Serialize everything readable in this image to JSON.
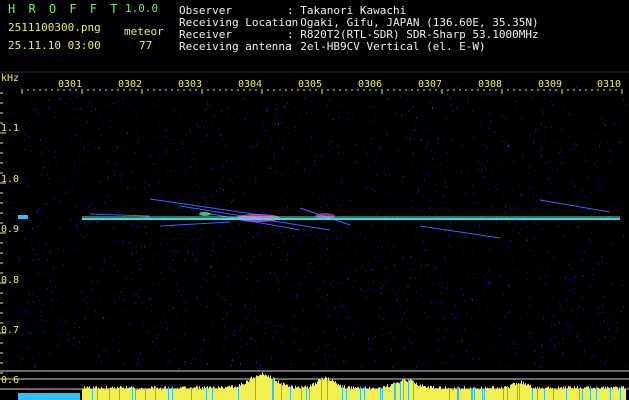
{
  "header": {
    "app_title": "H R O F F T",
    "version": "1.0.0",
    "filename": "2511100300.png",
    "datetime": "25.11.10 03:00",
    "meteor_label": "meteor",
    "meteor_count": "77",
    "fields": [
      {
        "label": "Observer",
        "value": ": Takanori Kawachi"
      },
      {
        "label": "Receiving Location",
        "value": ": Ogaki, Gifu, JAPAN (136.60E, 35.35N)"
      },
      {
        "label": "Receiver",
        "value": ": R820T2(RTL-SDR) SDR-Sharp 53.1000MHz"
      },
      {
        "label": "Receiving antenna",
        "value": ": 2el-HB9CV Vertical (el. E-W)"
      }
    ]
  },
  "axes": {
    "y_unit": "kHz",
    "y_ticks": [
      "1.1",
      "1.0",
      "0.9",
      "0.8",
      "0.7",
      "0.6"
    ],
    "x_ticks": [
      "0301",
      "0302",
      "0303",
      "0304",
      "0305",
      "0306",
      "0307",
      "0308",
      "0309",
      "0310"
    ]
  },
  "colors": {
    "background": "#000000",
    "noise": "#1a1aa0",
    "carrier": "#20e0ff",
    "meteor": "#ff40ff",
    "level_bar": "#f0f050",
    "level_bar_low": "#30c0ff"
  }
}
